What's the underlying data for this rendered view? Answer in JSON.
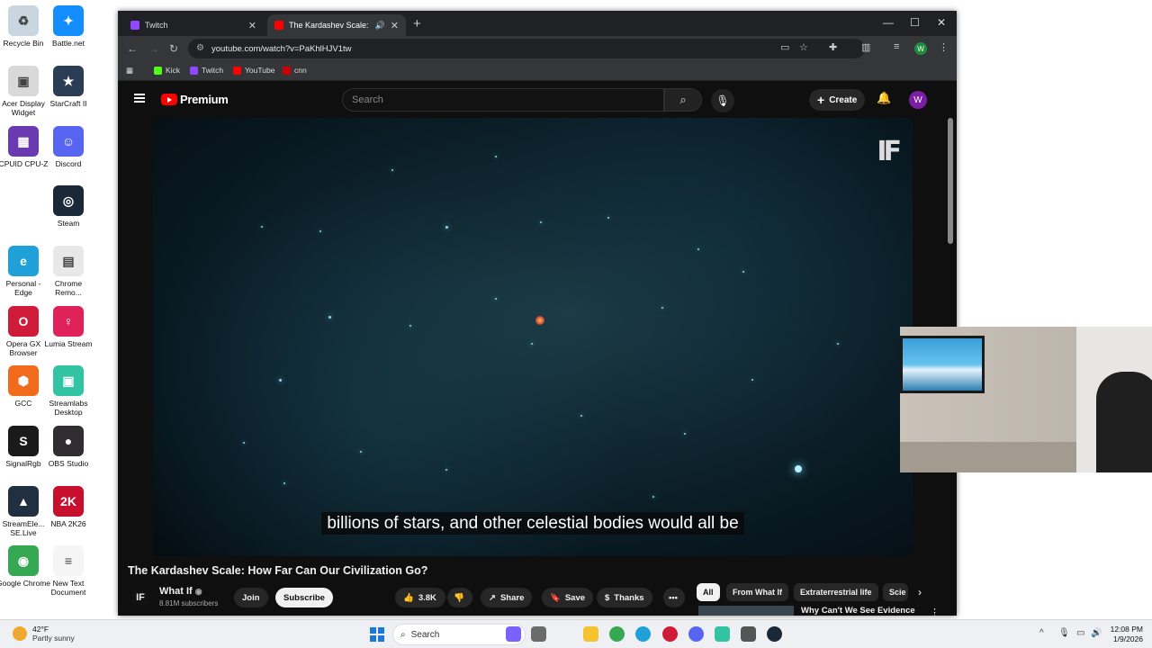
{
  "desktop": {
    "icons": [
      {
        "label": "Recycle Bin",
        "color": "#c9d6e0",
        "glyph": "♻"
      },
      {
        "label": "Battle.net",
        "color": "#148eff",
        "glyph": "✦"
      },
      {
        "label": "Acer Display Widget",
        "color": "#d9d9d9",
        "glyph": "▣"
      },
      {
        "label": "StarCraft II",
        "color": "#2b3d55",
        "glyph": "★"
      },
      {
        "label": "CPUID CPU-Z",
        "color": "#6a3ab0",
        "glyph": "▦"
      },
      {
        "label": "Discord",
        "color": "#5865f2",
        "glyph": "☺"
      },
      {
        "label": "Steam",
        "color": "#1b2838",
        "glyph": "◎"
      },
      {
        "label": "Personal - Edge",
        "color": "#1fa0d8",
        "glyph": "e"
      },
      {
        "label": "Chrome Remo...",
        "color": "#e8e8e8",
        "glyph": "▤"
      },
      {
        "label": "Opera GX Browser",
        "color": "#d01a3a",
        "glyph": "O"
      },
      {
        "label": "Lumia Stream",
        "color": "#e0225a",
        "glyph": "♀"
      },
      {
        "label": "GCC",
        "color": "#f26b1d",
        "glyph": "⬢"
      },
      {
        "label": "Streamlabs Desktop",
        "color": "#31c3a2",
        "glyph": "▣"
      },
      {
        "label": "SignalRgb",
        "color": "#1a1a1a",
        "glyph": "S"
      },
      {
        "label": "OBS Studio",
        "color": "#302e31",
        "glyph": "●"
      },
      {
        "label": "StreamEle... SE.Live",
        "color": "#203040",
        "glyph": "▲"
      },
      {
        "label": "NBA 2K26",
        "color": "#c8102e",
        "glyph": "2K"
      },
      {
        "label": "Google Chrome",
        "color": "#34a853",
        "glyph": "◉"
      },
      {
        "label": "New Text Document",
        "color": "#f5f5f5",
        "glyph": "≡"
      }
    ]
  },
  "browser": {
    "tabs": [
      {
        "title": "Twitch",
        "favicon_color": "#9146ff"
      },
      {
        "title": "The Kardashev Scale: How F",
        "favicon_color": "#ff0000"
      }
    ],
    "new_tab_glyph": "+",
    "address": "youtube.com/watch?v=PaKhlHJV1tw",
    "profile_initial": "W",
    "bookmarks": [
      {
        "label": "Kick",
        "color": "#53fc18"
      },
      {
        "label": "Twitch",
        "color": "#9146ff"
      },
      {
        "label": "YouTube",
        "color": "#ff0000"
      },
      {
        "label": "cnn",
        "color": "#cc0000"
      }
    ]
  },
  "youtube": {
    "logo_text": "Premium",
    "search_placeholder": "Search",
    "create_label": "Create",
    "avatar_initial": "W",
    "player": {
      "watermark": "IF",
      "caption": "billions of stars, and other celestial bodies would all be"
    },
    "video_title": "The Kardashev Scale: How Far Can Our Civilization Go?",
    "channel": {
      "avatar_text": "IF",
      "name": "What If",
      "subscribers": "8.81M subscribers"
    },
    "join_label": "Join",
    "subscribe_label": "Subscribe",
    "likes": "3.8K",
    "share_label": "Share",
    "save_label": "Save",
    "thanks_label": "Thanks",
    "chips": [
      "All",
      "From What If",
      "Extraterrestrial life",
      "Scie"
    ],
    "recommended_title": "Why Can't We See Evidence of Alien Life? | Documentary"
  },
  "taskbar": {
    "temperature": "42°F",
    "weather": "Partly sunny",
    "search_label": "Search",
    "time": "12:08 PM",
    "date": "1/9/2026",
    "apps": [
      {
        "name": "copilot",
        "color": "#7b61ff"
      },
      {
        "name": "task-view",
        "color": "#6b6b6b"
      },
      {
        "name": "explorer",
        "color": "#f4c430"
      },
      {
        "name": "chrome",
        "color": "#34a853"
      },
      {
        "name": "edge",
        "color": "#1fa0d8"
      },
      {
        "name": "opera",
        "color": "#d01a3a"
      },
      {
        "name": "discord",
        "color": "#5865f2"
      },
      {
        "name": "streamlabs",
        "color": "#31c3a2"
      },
      {
        "name": "signalrgb",
        "color": "#555555"
      },
      {
        "name": "steam",
        "color": "#1b2838"
      }
    ]
  }
}
